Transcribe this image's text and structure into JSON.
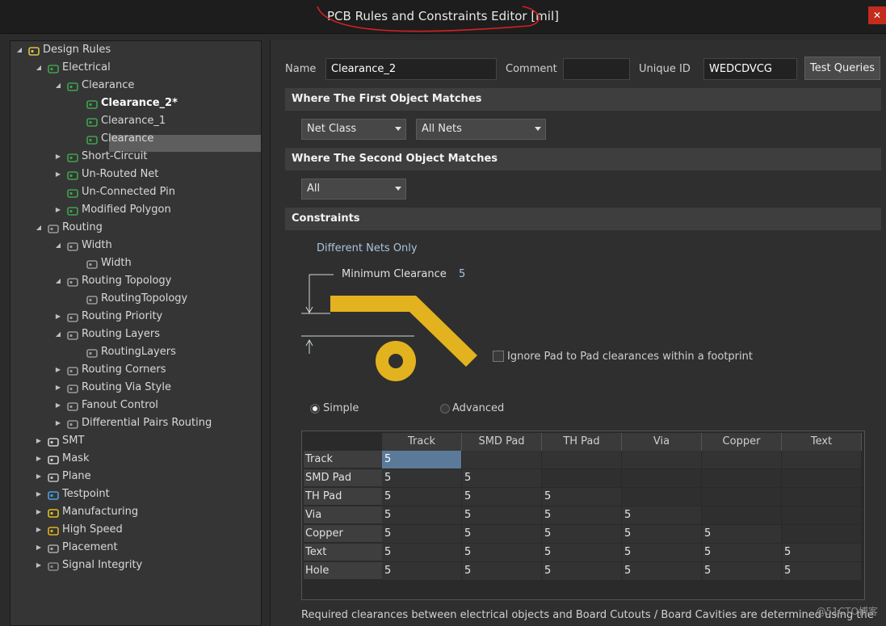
{
  "window": {
    "title": "PCB Rules and Constraints Editor [mil]"
  },
  "tree": [
    {
      "label": "Design Rules",
      "level": 0,
      "expanded": true,
      "icon": "folder-rules-icon"
    },
    {
      "label": "Electrical",
      "level": 1,
      "expanded": true,
      "icon": "rule-green-icon"
    },
    {
      "label": "Clearance",
      "level": 2,
      "expanded": true,
      "icon": "rule-green-icon"
    },
    {
      "label": "Clearance_2*",
      "level": 3,
      "icon": "rule-green-icon",
      "selected": true
    },
    {
      "label": "Clearance_1",
      "level": 3,
      "icon": "rule-green-icon"
    },
    {
      "label": "Clearance",
      "level": 3,
      "icon": "rule-green-icon"
    },
    {
      "label": "Short-Circuit",
      "level": 2,
      "expanded": false,
      "icon": "rule-green-icon"
    },
    {
      "label": "Un-Routed Net",
      "level": 2,
      "expanded": false,
      "icon": "rule-green-icon"
    },
    {
      "label": "Un-Connected Pin",
      "level": 2,
      "icon": "rule-green-icon"
    },
    {
      "label": "Modified Polygon",
      "level": 2,
      "expanded": false,
      "icon": "rule-green-icon"
    },
    {
      "label": "Routing",
      "level": 1,
      "expanded": true,
      "icon": "routing-icon"
    },
    {
      "label": "Width",
      "level": 2,
      "expanded": true,
      "icon": "routing-icon"
    },
    {
      "label": "Width",
      "level": 3,
      "icon": "routing-icon"
    },
    {
      "label": "Routing Topology",
      "level": 2,
      "expanded": true,
      "icon": "routing-icon"
    },
    {
      "label": "RoutingTopology",
      "level": 3,
      "icon": "routing-icon"
    },
    {
      "label": "Routing Priority",
      "level": 2,
      "expanded": false,
      "icon": "routing-icon"
    },
    {
      "label": "Routing Layers",
      "level": 2,
      "expanded": true,
      "icon": "routing-icon"
    },
    {
      "label": "RoutingLayers",
      "level": 3,
      "icon": "routing-icon"
    },
    {
      "label": "Routing Corners",
      "level": 2,
      "expanded": false,
      "icon": "routing-icon"
    },
    {
      "label": "Routing Via Style",
      "level": 2,
      "expanded": false,
      "icon": "routing-icon"
    },
    {
      "label": "Fanout Control",
      "level": 2,
      "expanded": false,
      "icon": "routing-icon"
    },
    {
      "label": "Differential Pairs Routing",
      "level": 2,
      "expanded": false,
      "icon": "routing-icon"
    },
    {
      "label": "SMT",
      "level": 1,
      "expanded": false,
      "icon": "smt-icon"
    },
    {
      "label": "Mask",
      "level": 1,
      "expanded": false,
      "icon": "mask-icon"
    },
    {
      "label": "Plane",
      "level": 1,
      "expanded": false,
      "icon": "plane-icon"
    },
    {
      "label": "Testpoint",
      "level": 1,
      "expanded": false,
      "icon": "testpoint-icon"
    },
    {
      "label": "Manufacturing",
      "level": 1,
      "expanded": false,
      "icon": "manufacturing-icon"
    },
    {
      "label": "High Speed",
      "level": 1,
      "expanded": false,
      "icon": "high-speed-icon"
    },
    {
      "label": "Placement",
      "level": 1,
      "expanded": false,
      "icon": "placement-icon"
    },
    {
      "label": "Signal Integrity",
      "level": 1,
      "expanded": false,
      "icon": "signal-integrity-icon"
    }
  ],
  "form": {
    "name_label": "Name",
    "name_value": "Clearance_2",
    "comment_label": "Comment",
    "comment_value": "",
    "uid_label": "Unique ID",
    "uid_value": "WEDCDVCG",
    "test_queries": "Test Queries"
  },
  "first_match": {
    "header": "Where The First Object Matches",
    "type": "Net Class",
    "value": "All Nets"
  },
  "second_match": {
    "header": "Where The Second Object Matches",
    "type": "All"
  },
  "constraints": {
    "header": "Constraints",
    "different_nets": "Different Nets Only",
    "min_clearance_label": "Minimum Clearance",
    "min_clearance_value": "5",
    "ignore_pad": "Ignore Pad to Pad clearances within a footprint",
    "ignore_pad_checked": false,
    "mode_simple": "Simple",
    "mode_advanced": "Advanced",
    "mode_selected": "Simple"
  },
  "matrix": {
    "columns": [
      "Track",
      "SMD Pad",
      "TH Pad",
      "Via",
      "Copper",
      "Text"
    ],
    "rows": [
      {
        "label": "Track",
        "values": [
          "5",
          "",
          "",
          "",
          "",
          ""
        ]
      },
      {
        "label": "SMD Pad",
        "values": [
          "5",
          "5",
          "",
          "",
          "",
          ""
        ]
      },
      {
        "label": "TH Pad",
        "values": [
          "5",
          "5",
          "5",
          "",
          "",
          ""
        ]
      },
      {
        "label": "Via",
        "values": [
          "5",
          "5",
          "5",
          "5",
          "",
          ""
        ]
      },
      {
        "label": "Copper",
        "values": [
          "5",
          "5",
          "5",
          "5",
          "5",
          ""
        ]
      },
      {
        "label": "Text",
        "values": [
          "5",
          "5",
          "5",
          "5",
          "5",
          "5"
        ]
      },
      {
        "label": "Hole",
        "values": [
          "5",
          "5",
          "5",
          "5",
          "5",
          "5"
        ]
      }
    ]
  },
  "footer_note": "Required clearances between electrical objects and Board Cutouts / Board Cavities are determined using the",
  "watermark": "@51CTO博客",
  "colors": {
    "copper": "#e2b21f",
    "selection": "#5b7a9a",
    "background": "#2b2b2b"
  }
}
